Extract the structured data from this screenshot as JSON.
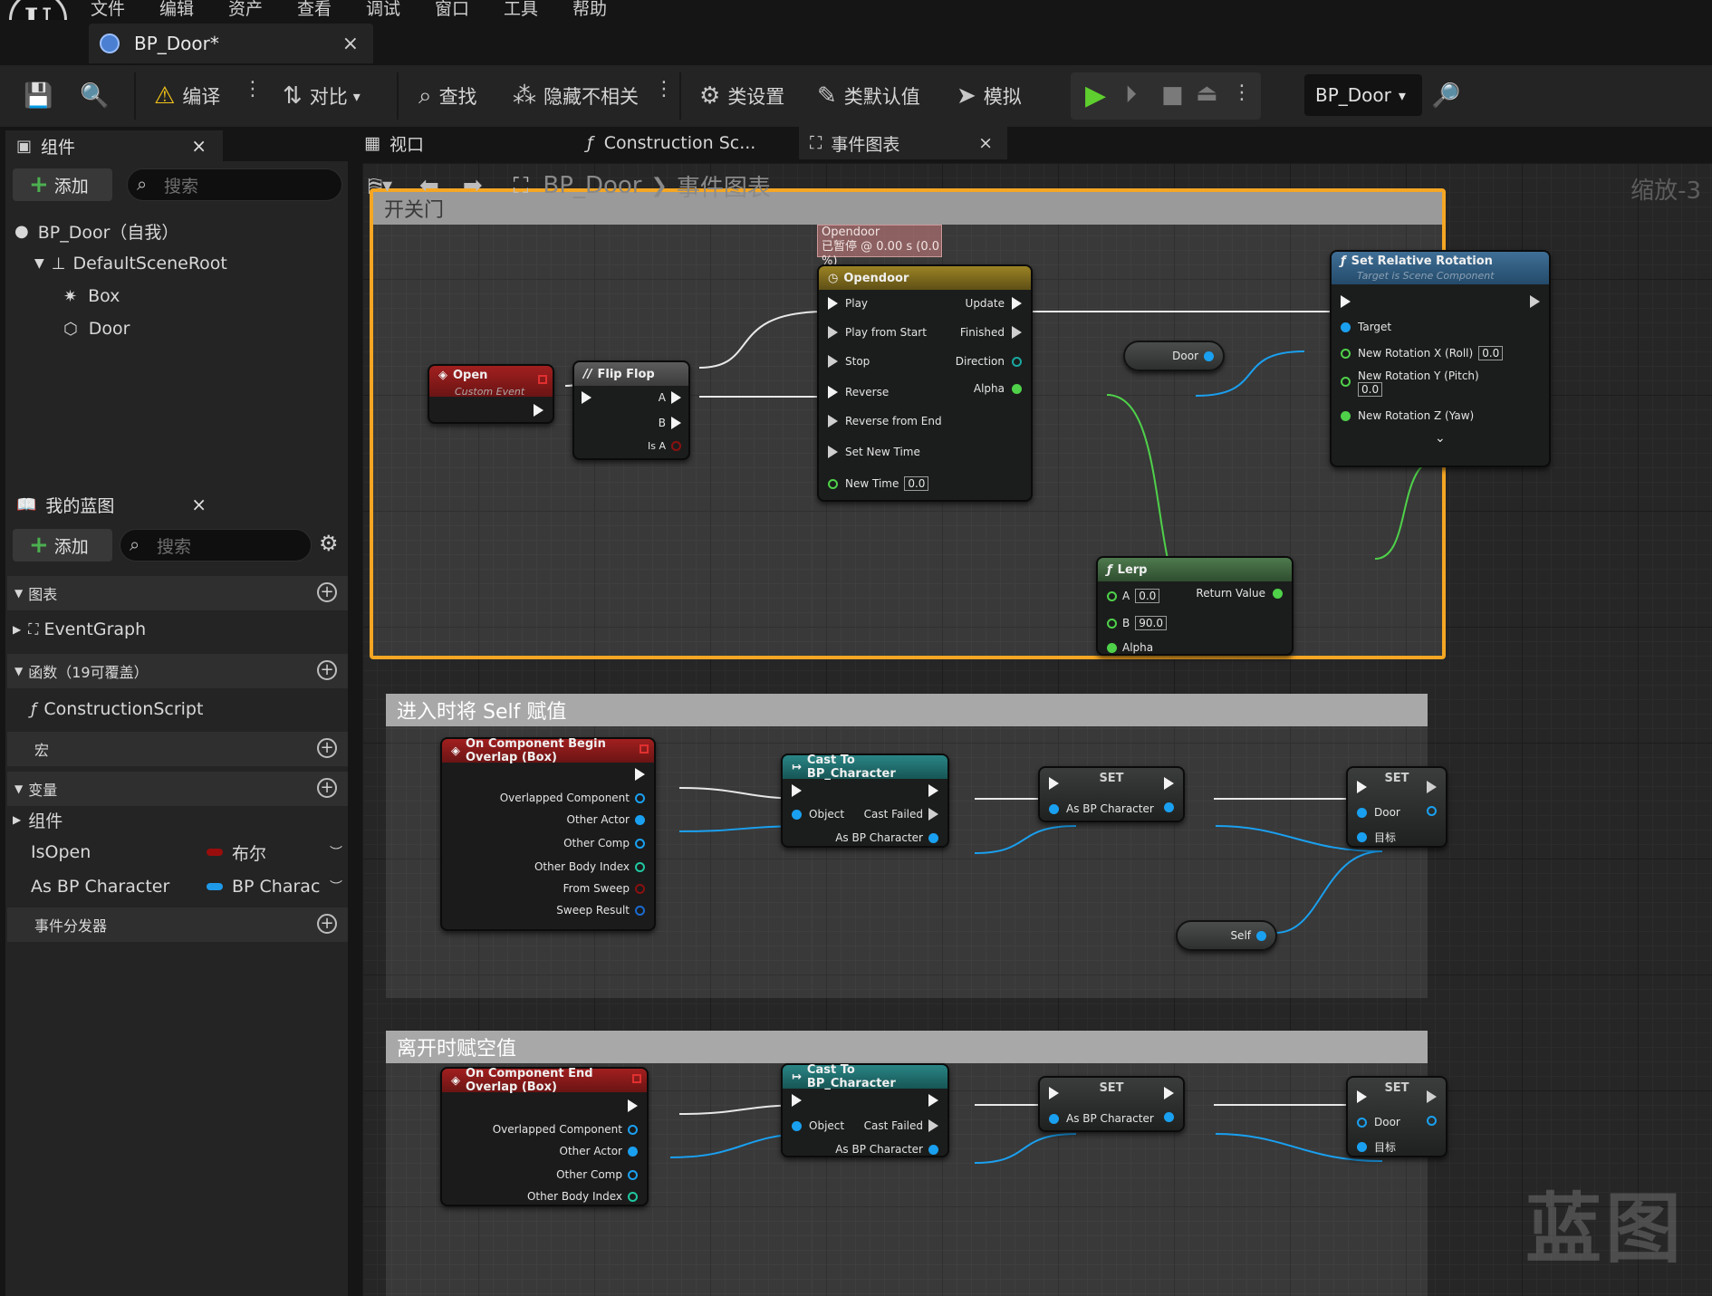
{
  "menu": [
    "文件",
    "编辑",
    "资产",
    "查看",
    "调试",
    "窗口",
    "工具",
    "帮助"
  ],
  "doc_tab": {
    "title": "BP_Door*",
    "close": "×"
  },
  "toolbar": {
    "compile": "编译",
    "diff": "对比",
    "find": "查找",
    "hide_unrelated": "隐藏不相关",
    "class_settings": "类设置",
    "class_defaults": "类默认值",
    "simulate": "模拟",
    "debug_object": "BP_Door"
  },
  "components_panel": {
    "title": "组件",
    "add": "添加",
    "search_placeholder": "搜索",
    "tree": [
      "BP_Door（自我）",
      "DefaultSceneRoot",
      "Box",
      "Door"
    ]
  },
  "mybp_panel": {
    "title": "我的蓝图",
    "add": "添加",
    "search_placeholder": "搜索",
    "sections": {
      "graphs": "图表",
      "graph_item": "EventGraph",
      "functions": "函数（19可覆盖）",
      "function_item": "ConstructionScript",
      "macros": "宏",
      "variables": "变量",
      "components_group": "组件",
      "dispatchers": "事件分发器"
    },
    "variables": [
      {
        "name": "IsOpen",
        "type": "布尔",
        "color": "#9a0d0d"
      },
      {
        "name": "As BP Character",
        "type": "BP Charac",
        "color": "#1f9ae8"
      }
    ]
  },
  "graph_tabs": [
    "视口",
    "Construction Sc...",
    "事件图表"
  ],
  "breadcrumb": {
    "bp": "BP_Door",
    "graph": "事件图表"
  },
  "zoom": "缩放-3",
  "watermark": "蓝图",
  "comments": [
    "开关门",
    "进入时将 Self 赋值",
    "离开时赋空值"
  ],
  "nodes": {
    "open": {
      "title": "Open",
      "sub": "Custom Event"
    },
    "flipflop": {
      "title": "Flip Flop",
      "pins": [
        "A",
        "B",
        "Is A"
      ]
    },
    "timeline_debug": {
      "line1": "Opendoor",
      "line2": "已暂停 @ 0.00 s (0.0 %)"
    },
    "timeline": {
      "title": "Opendoor",
      "inputs": [
        "Play",
        "Play from Start",
        "Stop",
        "Reverse",
        "Reverse from End",
        "Set New Time",
        "New Time"
      ],
      "outputs": [
        "Update",
        "Finished",
        "Direction",
        "Alpha"
      ],
      "new_time": "0.0"
    },
    "door_var": "Door",
    "setrot": {
      "title": "Set Relative Rotation",
      "sub": "Target is Scene Component",
      "pins": [
        "Target",
        "New Rotation X (Roll)",
        "New Rotation Y (Pitch)",
        "New Rotation Z (Yaw)"
      ],
      "x": "0.0",
      "y": "0.0"
    },
    "lerp": {
      "title": "Lerp",
      "a": "A",
      "b": "B",
      "alpha": "Alpha",
      "ret": "Return Value",
      "a_val": "0.0",
      "b_val": "90.0"
    },
    "begin_overlap": {
      "title": "On Component Begin Overlap (Box)",
      "pins": [
        "Overlapped Component",
        "Other Actor",
        "Other Comp",
        "Other Body Index",
        "From Sweep",
        "Sweep Result"
      ]
    },
    "end_overlap": {
      "title": "On Component End Overlap (Box)",
      "pins": [
        "Overlapped Component",
        "Other Actor",
        "Other Comp",
        "Other Body Index"
      ]
    },
    "cast": {
      "title": "Cast To BP_Character",
      "object": "Object",
      "failed": "Cast Failed",
      "as": "As BP Character"
    },
    "set": {
      "title": "SET",
      "as": "As BP Character"
    },
    "set2": {
      "title": "SET",
      "door": "Door",
      "target": "目标"
    },
    "self_var": "Self"
  },
  "colors": {
    "accent_orange": "#f5a623",
    "event_red": "#8d1b1b",
    "func_blue": "#2a5a84",
    "timeline_gold": "#8b7420",
    "exec": "#ffffff",
    "object_blue": "#1aa0f0",
    "float_green": "#4fd14a"
  }
}
